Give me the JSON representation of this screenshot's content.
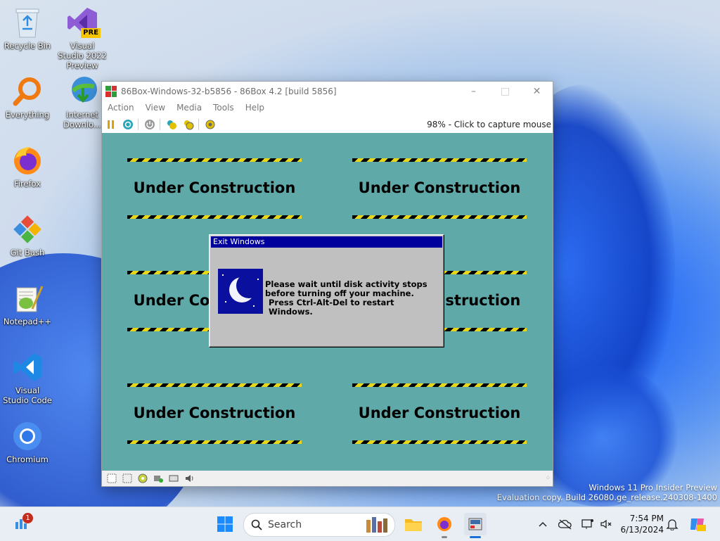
{
  "desktop_icons": [
    {
      "label": "Recycle Bin"
    },
    {
      "label": "Visual Studio 2022 Preview",
      "badge": "PRE"
    },
    {
      "label": "Everything"
    },
    {
      "label": "Internet Downlo..."
    },
    {
      "label": "Firefox"
    },
    {
      "label": "Git Bash"
    },
    {
      "label": "Notepad++"
    },
    {
      "label": "Visual Studio Code"
    },
    {
      "label": "Chromium"
    }
  ],
  "window": {
    "title": "86Box-Windows-32-b5856 - 86Box 4.2 [build 5856]",
    "menu": [
      "Action",
      "View",
      "Media",
      "Tools",
      "Help"
    ],
    "status_text": "98% - Click to capture mouse"
  },
  "guest": {
    "tiles": [
      "Under Construction",
      "Under Construction",
      "Under Construction",
      "Under Construction",
      "Under Construction",
      "Under Construction"
    ],
    "dialog": {
      "title": "Exit Windows",
      "line1": "Please wait until disk activity stops before turning off your machine.",
      "line2": "Press Ctrl-Alt-Del to restart Windows."
    }
  },
  "watermark": {
    "line1": "Windows 11 Pro Insider Preview",
    "line2": "Evaluation copy. Build 26080.ge_release.240308-1400"
  },
  "taskbar": {
    "widgets_badge": "1",
    "search_placeholder": "Search",
    "time": "7:54 PM",
    "date": "6/13/2024"
  },
  "colors": {
    "guest_background": "#5fa9a8",
    "dialog_title_bar": "#00009d",
    "taskbar": "#e9eef5"
  }
}
